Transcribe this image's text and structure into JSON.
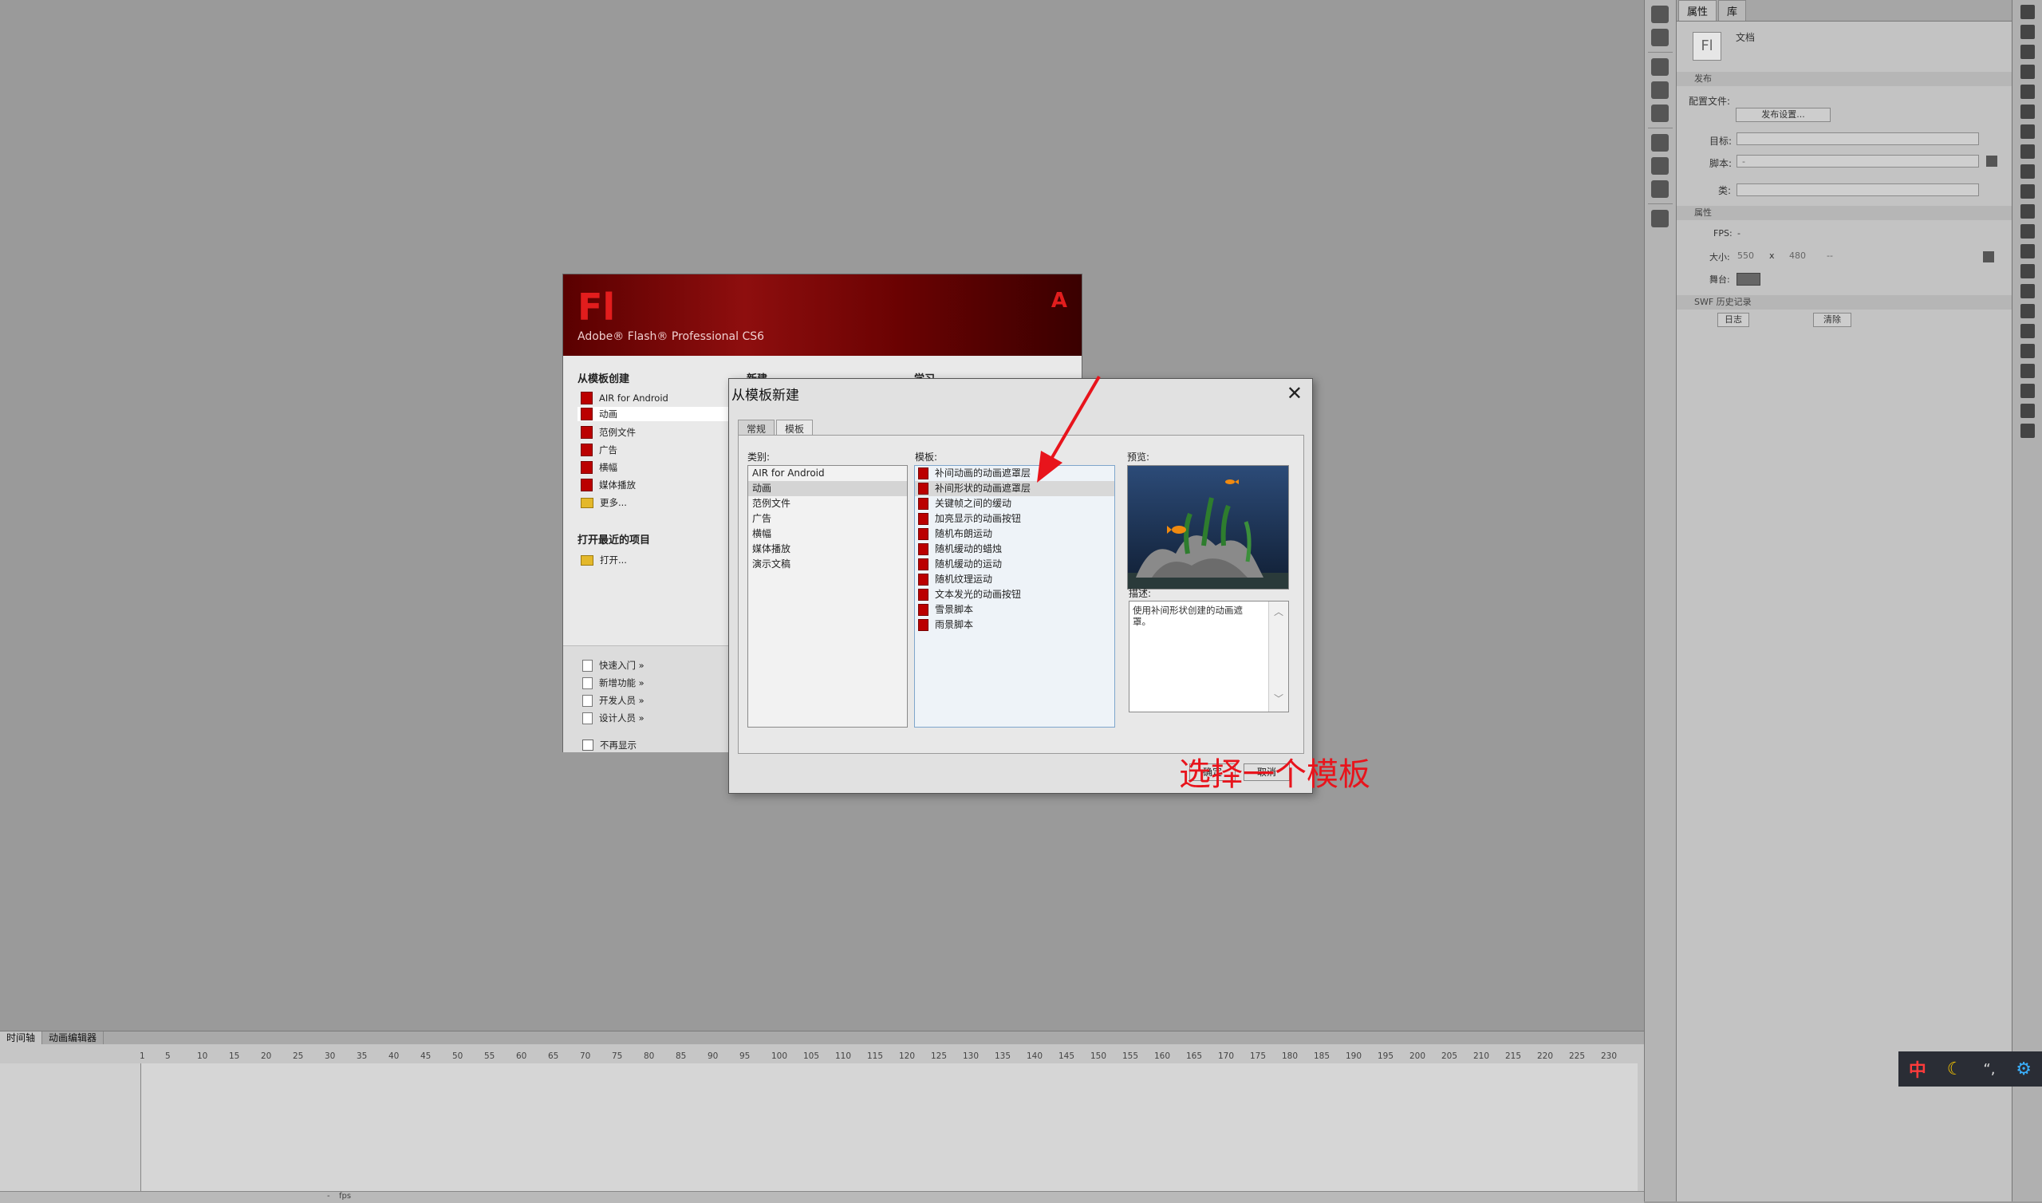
{
  "welcome": {
    "product": "Adobe® Flash® Professional CS6",
    "logo": "Fl",
    "adobe_logo": "Adobe",
    "create_from_template": "从模板创建",
    "templates": [
      "AIR for Android",
      "动画",
      "范例文件",
      "广告",
      "横幅",
      "媒体播放",
      "更多..."
    ],
    "new_header": "新建",
    "learn_header": "学习",
    "open_recent": "打开最近的项目",
    "open": "打开...",
    "links": [
      "快速入门 »",
      "新增功能 »",
      "开发人员 »",
      "设计人员 »"
    ],
    "dont_show": "不再显示"
  },
  "dialog": {
    "title": "从模板新建",
    "tabs": [
      "常规",
      "模板"
    ],
    "category_label": "类别:",
    "categories": [
      "AIR for Android",
      "动画",
      "范例文件",
      "广告",
      "横幅",
      "媒体播放",
      "演示文稿"
    ],
    "template_label": "模板:",
    "templates": [
      "补间动画的动画遮罩层",
      "补间形状的动画遮罩层",
      "关键帧之间的缓动",
      "加亮显示的动画按钮",
      "随机布朗运动",
      "随机缓动的蜡烛",
      "随机缓动的运动",
      "随机纹理运动",
      "文本发光的动画按钮",
      "雪景脚本",
      "雨景脚本"
    ],
    "preview_label": "预览:",
    "description_label": "描述:",
    "description": "使用补间形状创建的动画遮罩。",
    "ok": "确定",
    "cancel": "取消"
  },
  "annotation": "选择一个模板",
  "properties": {
    "tabs": [
      "属性",
      "库"
    ],
    "doc_icon": "Fl",
    "doc_label": "文档",
    "publish_section": "发布",
    "profile_label": "配置文件:",
    "publish_settings": "发布设置...",
    "target_label": "目标:",
    "script_label": "脚本:",
    "script_value": "-",
    "class_label": "类:",
    "props_section": "属性",
    "fps_label": "FPS:",
    "fps_value": "-",
    "size_label": "大小:",
    "width": "550",
    "x_sep": "x",
    "height": "480",
    "size_unit": "--",
    "stage_label": "舞台:",
    "swf_section": "SWF 历史记录",
    "log_button": "日志",
    "clear_button": "清除"
  },
  "timeline": {
    "tabs": [
      "时间轴",
      "动画编辑器"
    ],
    "ruler": [
      "1",
      "5",
      "10",
      "15",
      "20",
      "25",
      "30",
      "35",
      "40",
      "45",
      "50",
      "55",
      "60",
      "65",
      "70",
      "75",
      "80",
      "85",
      "90",
      "95",
      "100",
      "105",
      "110",
      "115",
      "120",
      "125",
      "130",
      "135",
      "140",
      "145",
      "150",
      "155",
      "160",
      "165",
      "170",
      "175",
      "180",
      "185",
      "190",
      "195",
      "200",
      "205",
      "210",
      "215",
      "220",
      "225",
      "230"
    ],
    "fps_text": "fps",
    "fps_value": "-"
  },
  "ime": {
    "lang": "中",
    "moon": "☾",
    "quote": "“,",
    "gear": "⚙"
  },
  "colors": {
    "accent_red": "#e8141c",
    "banner_red": "#8e0e0e",
    "stage_color": "#666666"
  }
}
